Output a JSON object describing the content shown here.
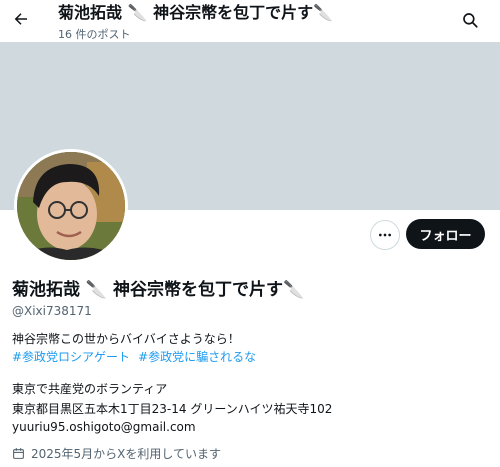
{
  "header": {
    "title": "菊池拓哉 🔪 神谷宗幣を包丁で片す🔪",
    "post_count": "16 件のポスト"
  },
  "profile": {
    "name": "菊池拓哉 🔪 神谷宗幣を包丁で片す🔪",
    "handle": "@Xixi738171",
    "follow_label": "フォロー",
    "bio_line1": "神谷宗幣この世からバイバイさようなら！",
    "hashtags": [
      "#参政党ロシアゲート",
      "#参政党に騙されるな"
    ],
    "bio_line3": "東京で共産党のボランティア",
    "bio_line4": "東京都目黒区五本木1丁目23-14 グリーンハイツ祐天寺102",
    "email": "yuuriu95.oshigoto@gmail.com",
    "joined": "2025年5月からXを利用しています"
  },
  "icons": [
    "back-arrow-icon",
    "search-icon",
    "more-icon",
    "calendar-icon"
  ],
  "colors": {
    "banner": "#cfd9de",
    "link": "#1d9bf0",
    "follow_bg": "#0f1419",
    "muted": "#536471"
  }
}
